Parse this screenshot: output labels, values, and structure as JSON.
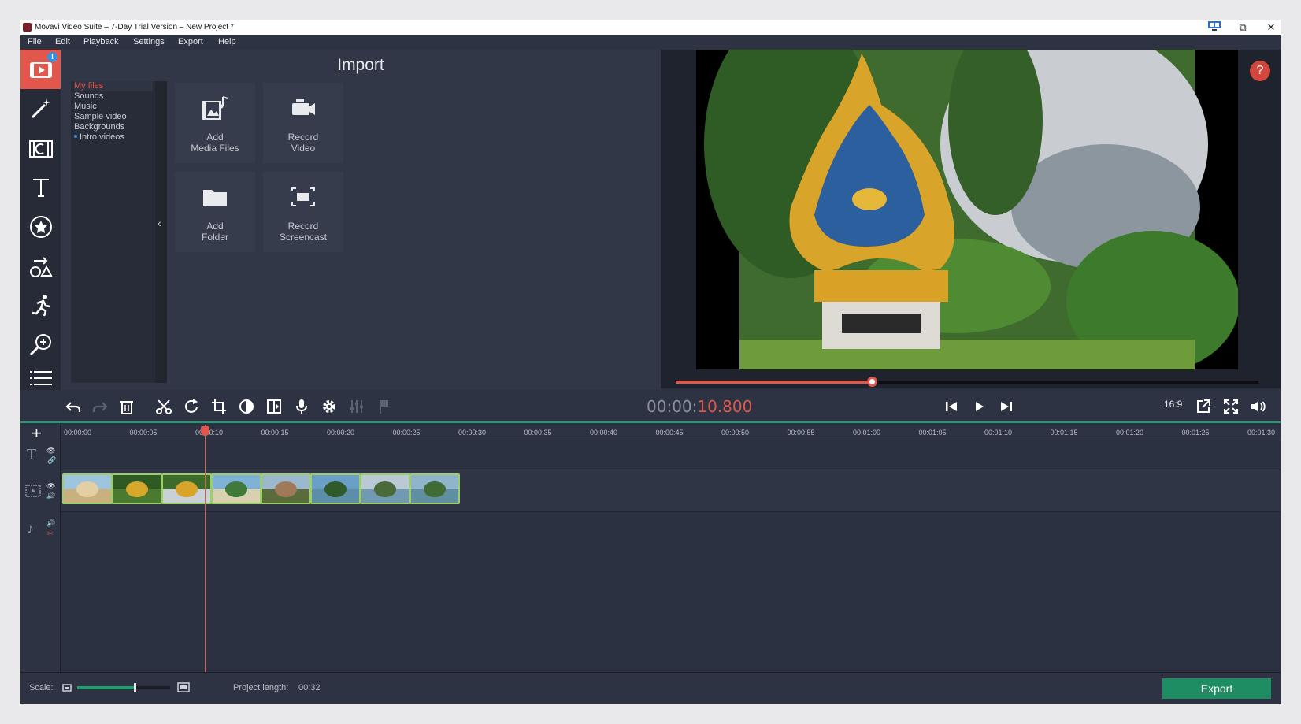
{
  "window": {
    "title": "Movavi Video Suite – 7-Day Trial Version – New Project *"
  },
  "menu": [
    "File",
    "Edit",
    "Playback",
    "Settings",
    "Export",
    "Help"
  ],
  "sidebar": {
    "badge": "!",
    "items": [
      "import-icon",
      "magic-wand-icon",
      "filters-icon",
      "titles-icon",
      "stickers-icon",
      "shapes-icon",
      "transitions-icon",
      "zoom-icon",
      "menu-icon"
    ]
  },
  "import": {
    "title": "Import",
    "categories": [
      "My files",
      "Sounds",
      "Music",
      "Sample video",
      "Backgrounds",
      "Intro videos"
    ],
    "selected_category": "My files",
    "collapse_glyph": "‹",
    "tiles": [
      {
        "label": "Add\nMedia Files",
        "icon": "media-files-icon"
      },
      {
        "label": "Record\nVideo",
        "icon": "camera-icon"
      },
      {
        "label": "Add\nFolder",
        "icon": "folder-icon"
      },
      {
        "label": "Record\nScreencast",
        "icon": "screencast-icon"
      }
    ]
  },
  "preview": {
    "help": "?",
    "progress": 0.337
  },
  "player": {
    "timecode_gray": "00:00:",
    "timecode_red": "10.800",
    "aspect_ratio": "16:9"
  },
  "timeline": {
    "ticks": [
      "00:00:00",
      "00:00:05",
      "00:00:10",
      "00:00:15",
      "00:00:20",
      "00:00:25",
      "00:00:30",
      "00:00:35",
      "00:00:40",
      "00:00:45",
      "00:00:50",
      "00:00:55",
      "00:01:00",
      "00:01:05",
      "00:01:10",
      "00:01:15",
      "00:01:20",
      "00:01:25",
      "00:01:30"
    ],
    "clips": 8
  },
  "bottom": {
    "scale_label": "Scale:",
    "scale_value": 0.62,
    "project_length_label": "Project length:",
    "project_length_value": "00:32",
    "export_label": "Export"
  },
  "colors": {
    "accent": "#e2574c",
    "export": "#1f8d63",
    "clip_border": "#9ccf6a"
  }
}
